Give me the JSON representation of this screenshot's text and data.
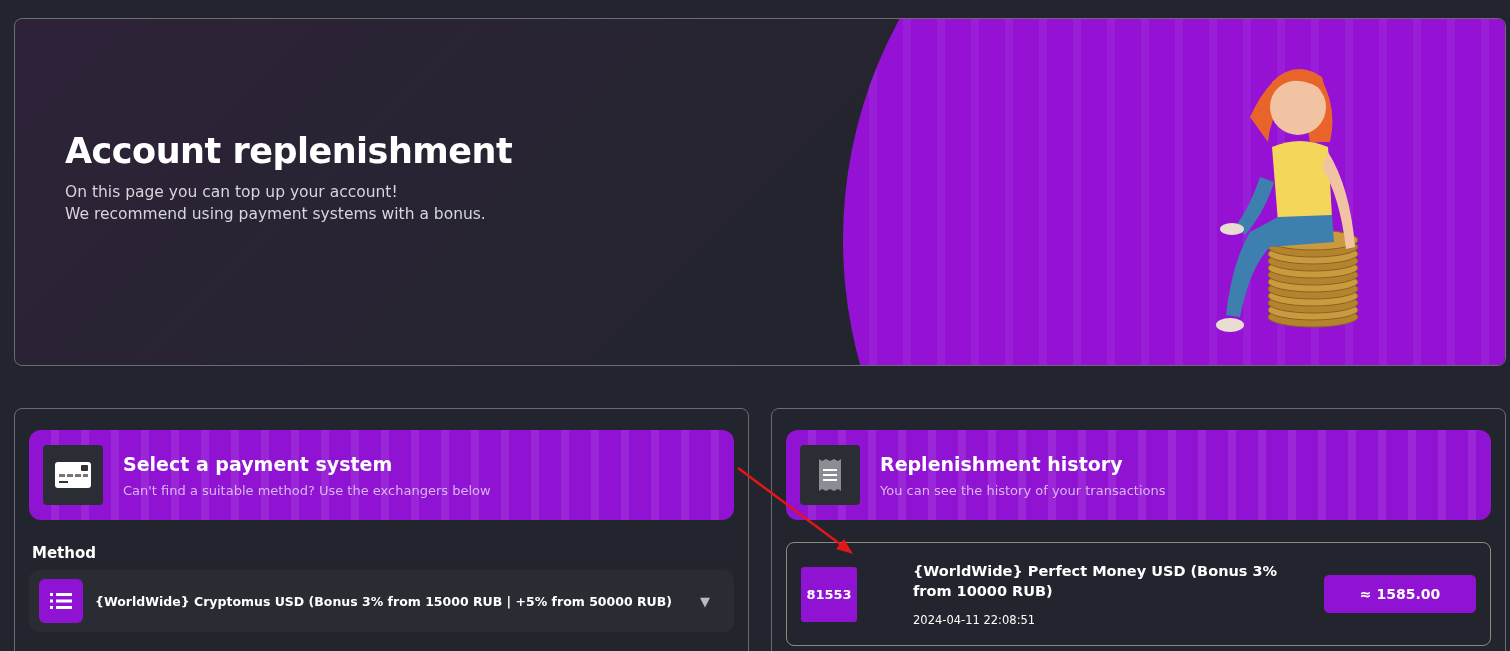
{
  "banner": {
    "title": "Account replenishment",
    "lines": [
      "On this page you can top up your account!",
      "We recommend using payment systems with a bonus."
    ]
  },
  "payment": {
    "title": "Select a payment system",
    "subtitle": "Can't find a suitable method? Use the exchangers below",
    "method_label": "Method",
    "method": {
      "value": "{WorldWide} Cryptomus USD (Bonus 3% from 15000 RUB | +5% from 50000 RUB)",
      "caret": "▼"
    }
  },
  "history": {
    "title": "Replenishment history",
    "subtitle": "You can see the history of your transactions",
    "transactions": [
      {
        "id": "81553",
        "name": "{WorldWide} Perfect Money USD (Bonus 3% from 10000 RUB)",
        "date": "2024-04-11 22:08:51",
        "amount": "≈ 1585.00"
      }
    ]
  }
}
